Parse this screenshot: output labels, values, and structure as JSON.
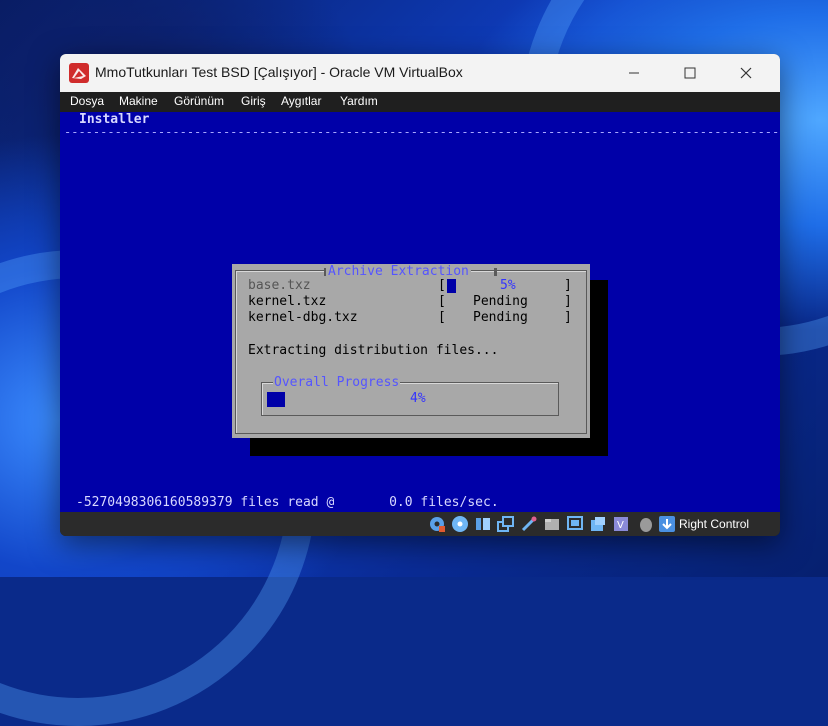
{
  "window": {
    "title": "MmoTutkunları Test BSD [Çalışıyor] - Oracle VM VirtualBox"
  },
  "menu": [
    "Dosya",
    "Makine",
    "Görünüm",
    "Giriş",
    "Aygıtlar",
    "Yardım"
  ],
  "guest": {
    "header": "Installer",
    "divider": "----------------------------------------------------------------------------------------------------------------------",
    "dialog": {
      "title": "Archive Extraction",
      "files": [
        {
          "name": "base.txz",
          "status": "5%",
          "progress": 0.05
        },
        {
          "name": "kernel.txz",
          "status": "Pending"
        },
        {
          "name": "kernel-dbg.txz",
          "status": "Pending"
        }
      ],
      "message": "Extracting distribution files...",
      "overall": {
        "title": "Overall Progress",
        "percent_label": "4%",
        "progress": 0.04
      }
    },
    "footer": "-5270498306160589379 files read @       0.0 files/sec."
  },
  "statusbar": {
    "host_key": "Right Control",
    "icons": [
      "hard-disk-icon",
      "optical-drive-icon",
      "audio-icon",
      "network-icon",
      "usb-icon",
      "shared-folders-icon",
      "display-icon",
      "recording-icon",
      "virtualization-icon",
      "mouse-integration-icon",
      "host-key-icon"
    ]
  },
  "colors": {
    "guest_bg": "#0000a8",
    "dialog_bg": "#a8a8a8",
    "dialog_title": "#5555ff"
  }
}
